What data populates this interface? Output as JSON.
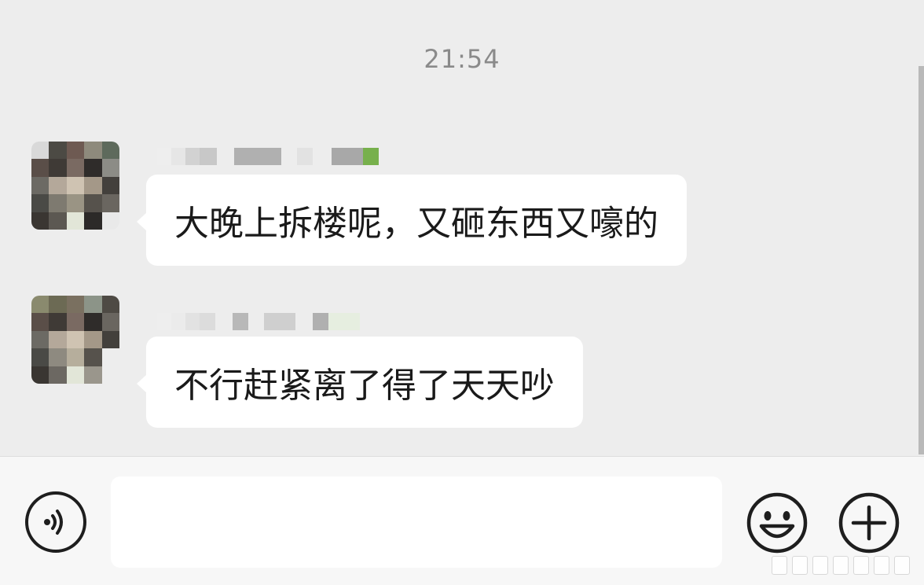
{
  "chat": {
    "timestamp": "21:54",
    "messages": [
      {
        "text": "大晚上拆楼呢，又砸东西又嚎的"
      },
      {
        "text": "不行赶紧离了得了天天吵"
      }
    ]
  },
  "input_bar": {
    "input_value": "",
    "voice_icon": "voice-icon",
    "emoji_icon": "emoji-icon",
    "plus_icon": "plus-icon"
  },
  "colors": {
    "background": "#ededed",
    "bubble": "#ffffff",
    "timestamp": "#8a8a8a",
    "input_bar": "#f7f7f7"
  }
}
